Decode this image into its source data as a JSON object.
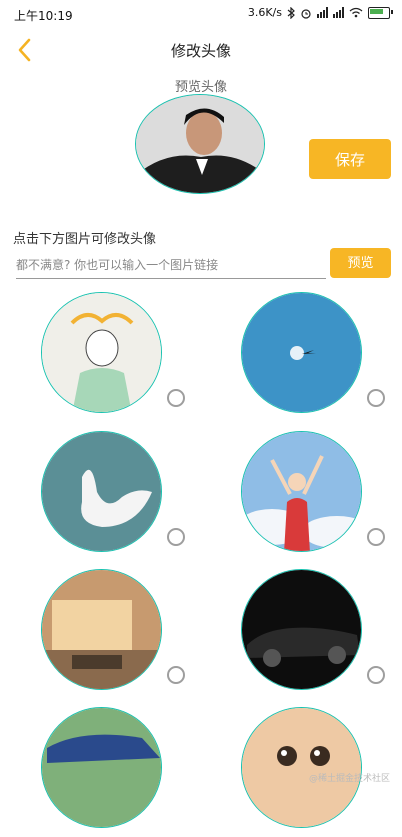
{
  "status_bar": {
    "time": "上午10:19",
    "speed": "3.6K/s"
  },
  "nav": {
    "title": "修改头像",
    "back_icon": "chevron-left-icon"
  },
  "preview": {
    "label": "预览头像",
    "save_label": "保存"
  },
  "hint": "点击下方图片可修改头像",
  "input": {
    "placeholder": "都不满意? 你也可以输入一个图片链接",
    "button_label": "预览"
  },
  "gallery": [
    {
      "name": "anime-boy"
    },
    {
      "name": "moon-plane"
    },
    {
      "name": "swan"
    },
    {
      "name": "girl-sky"
    },
    {
      "name": "room"
    },
    {
      "name": "black-car"
    },
    {
      "name": "blue-car"
    },
    {
      "name": "cat"
    }
  ],
  "colors": {
    "accent": "#f7b625",
    "ring": "#19c2b0"
  },
  "watermark": "@稀土掘金技术社区"
}
